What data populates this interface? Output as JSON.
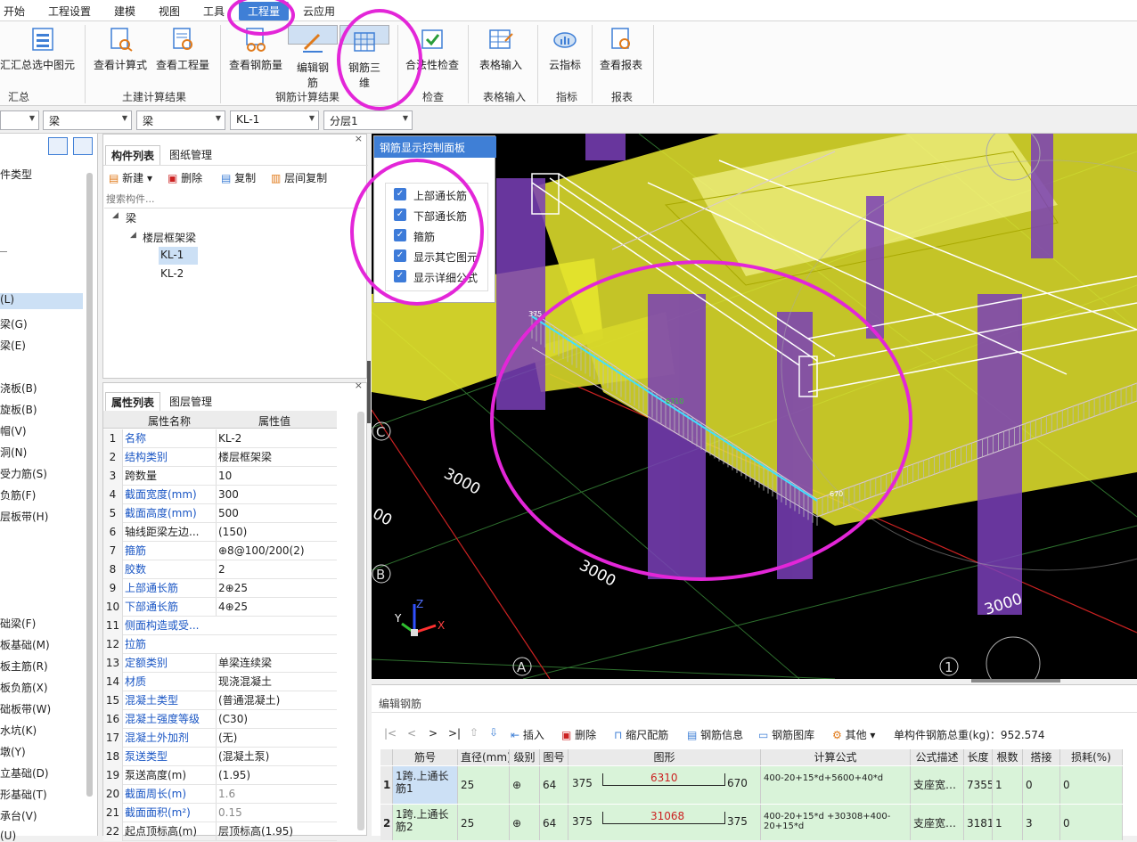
{
  "menu": {
    "items": [
      "开始",
      "工程设置",
      "建模",
      "视图",
      "工具",
      "工程量",
      "云应用"
    ],
    "active": "工程量"
  },
  "ribbon": {
    "buttons": [
      "汇总选中图元",
      "查看计算式",
      "查看工程量",
      "查看钢筋量",
      "编辑钢筋",
      "钢筋三维",
      "合法性检查",
      "表格输入",
      "云指标",
      "查看报表"
    ],
    "groups": [
      "汇总",
      "土建计算结果",
      "钢筋计算结果",
      "检查",
      "表格输入",
      "指标",
      "报表"
    ]
  },
  "selectors": [
    "",
    "梁",
    "梁",
    "KL-1",
    "分层1"
  ],
  "leftnav": {
    "header": "件类型",
    "items": [
      "(L)",
      "梁(G)",
      "梁(E)",
      "浇板(B)",
      "旋板(B)",
      "帽(V)",
      "洞(N)",
      "受力筋(S)",
      "负筋(F)",
      "层板带(H)",
      "础梁(F)",
      "板基础(M)",
      "板主筋(R)",
      "板负筋(X)",
      "础板带(W)",
      "水坑(K)",
      "墩(Y)",
      "立基础(D)",
      "形基础(T)",
      "承台(V)",
      "(U)"
    ],
    "selected": "(L)"
  },
  "complist": {
    "tabs": [
      "构件列表",
      "图纸管理"
    ],
    "tools": [
      "新建",
      "删除",
      "复制",
      "层间复制"
    ],
    "search_placeholder": "搜索构件...",
    "tree": {
      "root": "梁",
      "child": "楼层框架梁",
      "leaves": [
        "KL-1",
        "KL-2"
      ],
      "selected": "KL-1"
    }
  },
  "props": {
    "tabs": [
      "属性列表",
      "图层管理"
    ],
    "headers": [
      "属性名称",
      "属性值"
    ],
    "rows": [
      {
        "n": "1",
        "k": "名称",
        "v": "KL-2",
        "blue": true
      },
      {
        "n": "2",
        "k": "结构类别",
        "v": "楼层框架梁",
        "blue": true
      },
      {
        "n": "3",
        "k": "跨数量",
        "v": "10",
        "blue": false
      },
      {
        "n": "4",
        "k": "截面宽度(mm)",
        "v": "300",
        "blue": true
      },
      {
        "n": "5",
        "k": "截面高度(mm)",
        "v": "500",
        "blue": true
      },
      {
        "n": "6",
        "k": "轴线距梁左边...",
        "v": "(150)",
        "blue": false
      },
      {
        "n": "7",
        "k": "箍筋",
        "v": "⊕8@100/200(2)",
        "blue": true
      },
      {
        "n": "8",
        "k": "胶数",
        "v": "2",
        "blue": true
      },
      {
        "n": "9",
        "k": "上部通长筋",
        "v": "2⊕25",
        "blue": true
      },
      {
        "n": "10",
        "k": "下部通长筋",
        "v": "4⊕25",
        "blue": true
      },
      {
        "n": "11",
        "k": "侧面构造或受...",
        "v": "",
        "blue": true
      },
      {
        "n": "12",
        "k": "拉筋",
        "v": "",
        "blue": true
      },
      {
        "n": "13",
        "k": "定额类别",
        "v": "单梁连续梁",
        "blue": true
      },
      {
        "n": "14",
        "k": "材质",
        "v": "现浇混凝土",
        "blue": true
      },
      {
        "n": "15",
        "k": "混凝土类型",
        "v": "(普通混凝土)",
        "blue": true
      },
      {
        "n": "16",
        "k": "混凝土强度等级",
        "v": "(C30)",
        "blue": true
      },
      {
        "n": "17",
        "k": "混凝土外加剂",
        "v": "(无)",
        "blue": true
      },
      {
        "n": "18",
        "k": "泵送类型",
        "v": "(混凝土泵)",
        "blue": true
      },
      {
        "n": "19",
        "k": "泵送高度(m)",
        "v": "(1.95)",
        "blue": false
      },
      {
        "n": "20",
        "k": "截面周长(m)",
        "v": "1.6",
        "blue": true,
        "gray": true
      },
      {
        "n": "21",
        "k": "截面面积(m²)",
        "v": "0.15",
        "blue": true,
        "gray": true
      },
      {
        "n": "22",
        "k": "起点顶标高(m)",
        "v": "层顶标高(1.95)",
        "blue": false
      }
    ]
  },
  "control_panel": {
    "title": "钢筋显示控制面板",
    "options": [
      "上部通长筋",
      "下部通长筋",
      "箍筋",
      "显示其它图元",
      "显示详细公式"
    ]
  },
  "view3d": {
    "axis_labels": [
      "C",
      "B",
      "A",
      "1"
    ],
    "dims": [
      "3000",
      "3000",
      "3000",
      "00"
    ],
    "beam_labels": [
      "375",
      "670",
      "6310"
    ]
  },
  "edit": {
    "title": "编辑钢筋",
    "toolbar": [
      "插入",
      "删除",
      "缩尺配筋",
      "钢筋信息",
      "钢筋图库",
      "其他"
    ],
    "total_label": "单构件钢筋总重(kg)：952.574",
    "headers": [
      "筋号",
      "直径(mm)",
      "级别",
      "图号",
      "图形",
      "计算公式",
      "公式描述",
      "长度",
      "根数",
      "搭接",
      "损耗(%)"
    ],
    "rows": [
      {
        "no": "1",
        "name": "1跨.上通长筋1",
        "dia": "25",
        "grade": "⊕",
        "fig": "64",
        "l": "375",
        "mid": "6310",
        "r": "670",
        "formula": "400-20+15*d+5600+40*d",
        "desc": "支座宽…",
        "len": "7355",
        "count": "1",
        "lap": "0",
        "loss": "0"
      },
      {
        "no": "2",
        "name": "1跨.上通长筋2",
        "dia": "25",
        "grade": "⊕",
        "fig": "64",
        "l": "375",
        "mid": "31068",
        "r": "375",
        "formula": "400-20+15*d +30308+400-20+15*d",
        "desc": "支座宽…",
        "len": "31818",
        "count": "1",
        "lap": "3",
        "loss": "0"
      }
    ]
  },
  "colors": {
    "accent": "#3f7fd6",
    "annotation": "#e326d8",
    "concrete": "#e6e62e",
    "column": "#7a3fb8"
  }
}
